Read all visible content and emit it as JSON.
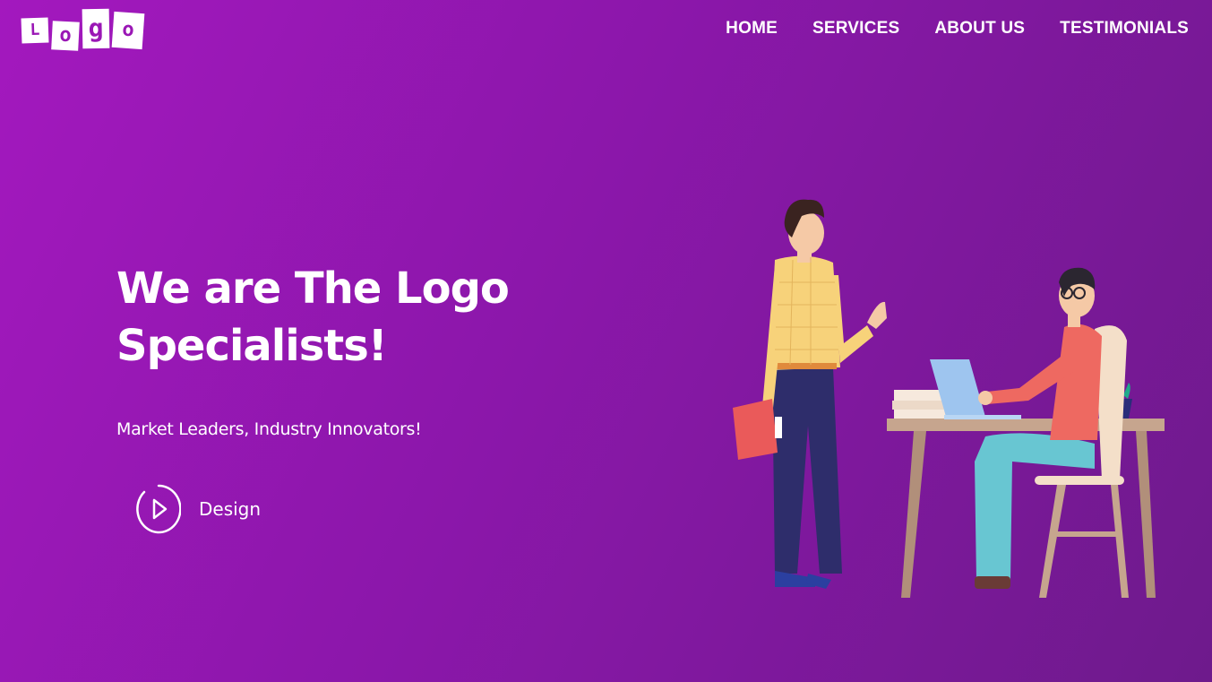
{
  "logo": {
    "letters": [
      "L",
      "o",
      "g",
      "o"
    ]
  },
  "nav": {
    "items": [
      {
        "label": "HOME"
      },
      {
        "label": "SERVICES"
      },
      {
        "label": "ABOUT US"
      },
      {
        "label": "TESTIMONIALS"
      }
    ]
  },
  "hero": {
    "title_line1": "We are The Logo",
    "title_line2": "Specialists!",
    "tagline": "Market Leaders, Industry Innovators!",
    "play_label": "Design"
  },
  "colors": {
    "gradient_start": "#a318be",
    "gradient_end": "#6e1a8c",
    "text": "#ffffff"
  },
  "icons": [
    "play-circle-icon",
    "office-illustration"
  ]
}
